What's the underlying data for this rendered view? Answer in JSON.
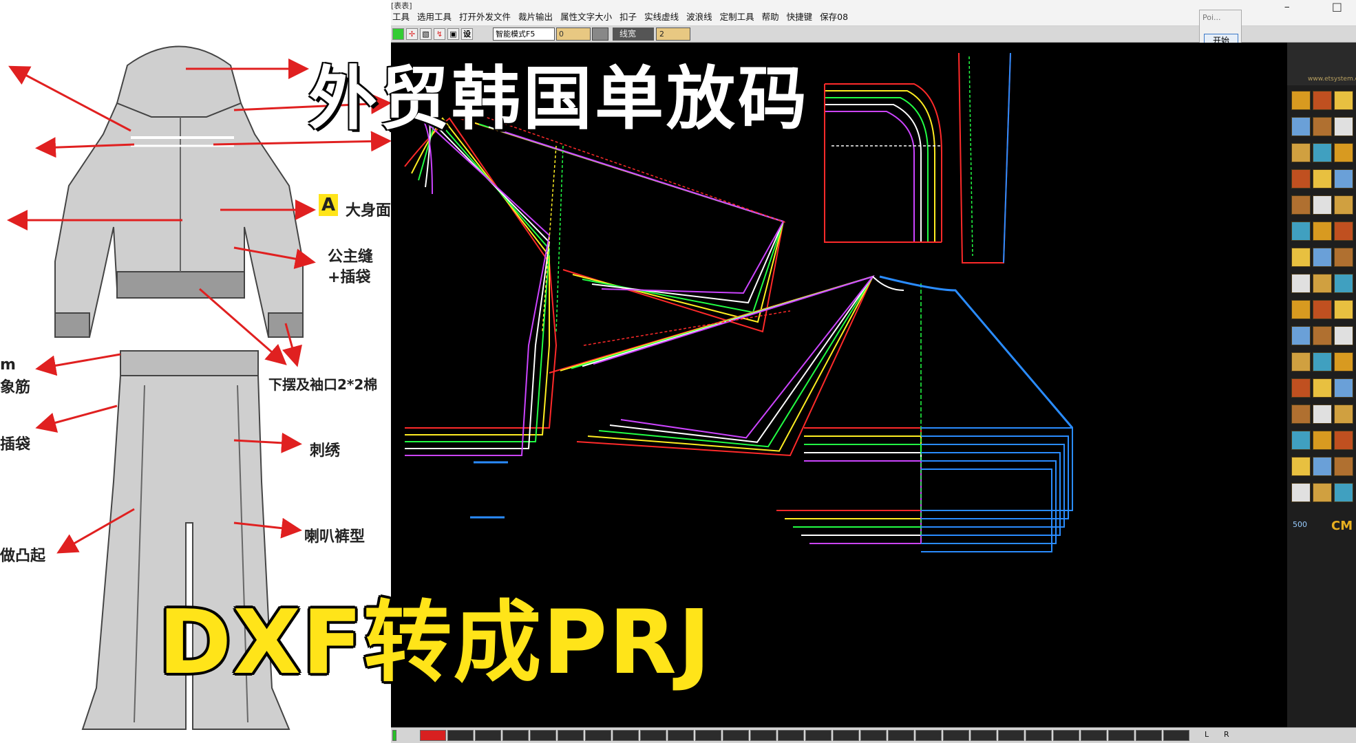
{
  "sketch": {
    "labels": {
      "a_badge": "A",
      "body_fabric": "大身面",
      "princess_seam": "公主缝",
      "insert_pocket": "+插袋",
      "hem_cuff": "下摆及袖口2*2棉",
      "embroidery": "刺绣",
      "flare_pants": "喇叭裤型",
      "cut_m": "m",
      "cut_elastic": "象筋",
      "cut_pocket": "插袋",
      "cut_raised": "做凸起"
    }
  },
  "cad": {
    "title_stub": "[表表]",
    "menu": [
      "工具",
      "选用工具",
      "打开外发文件",
      "裁片输出",
      "属性文字大小",
      "扣子",
      "实线虚线",
      "波浪线",
      "定制工具",
      "帮助",
      "快捷键",
      "保存08"
    ],
    "toolbar": {
      "settings_label": "设",
      "mode_select": "智能模式F5",
      "value_a": "0",
      "linewidth_label": "线宽",
      "linewidth_value": "2"
    },
    "popup": {
      "title": "Poi...",
      "start_button": "开始"
    },
    "right_panel": {
      "url": "www.etsystem.c",
      "cm_label": "CM",
      "number": "500"
    },
    "statusbar": {
      "left": "L",
      "right": "R"
    }
  },
  "overlay": {
    "headline": "外贸韩国单放码",
    "subline": "DXF转成PRJ"
  },
  "colors": {
    "grade_lines": [
      "#ff2a2a",
      "#ffee22",
      "#22ff44",
      "#ffffff",
      "#cc44ff"
    ],
    "blue_piece": "#2a8cff",
    "accent_yellow": "#ffe419"
  }
}
